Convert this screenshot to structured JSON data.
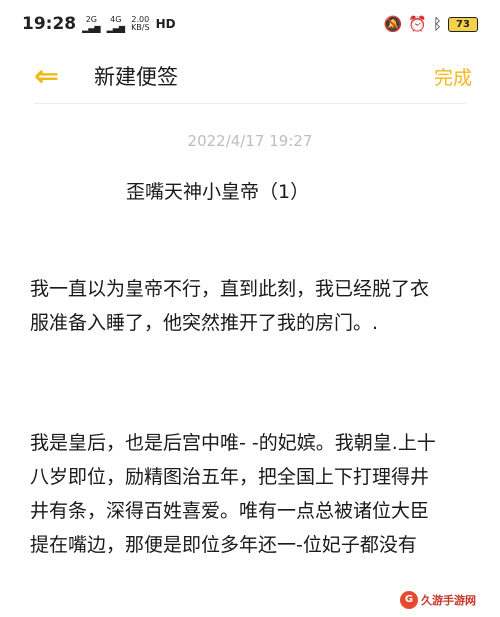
{
  "status_bar": {
    "time": "19:28",
    "signal_1": "2G",
    "signal_2": "4G",
    "net_speed_value": "2.00",
    "net_speed_unit": "KB/S",
    "hd_label": "HD",
    "battery_level": "73",
    "icons": [
      "mute-icon",
      "alarm-icon",
      "bluetooth-icon",
      "battery-icon"
    ]
  },
  "header": {
    "title": "新建便签",
    "done_label": "完成",
    "accent_color": "#f3b71a"
  },
  "note": {
    "timestamp": "2022/4/17 19:27",
    "title": "歪嘴天神小皇帝（1）",
    "paragraphs": [
      [
        "我一直以为皇帝不行，直到此刻，我已经脱了衣",
        "服准备入睡了，他突然推开了我的房门。."
      ],
      [
        "我是皇后，也是后宫中唯- -的妃嫔。我朝皇.上十",
        "八岁即位，励精图治五年，把全国上下打理得井",
        "井有条，深得百姓喜爱。唯有一点总被诸位大臣",
        "提在嘴边，那便是即位多年还一-位妃子都没有"
      ]
    ]
  },
  "watermark": {
    "badge": "G",
    "text": "久游手游网"
  }
}
